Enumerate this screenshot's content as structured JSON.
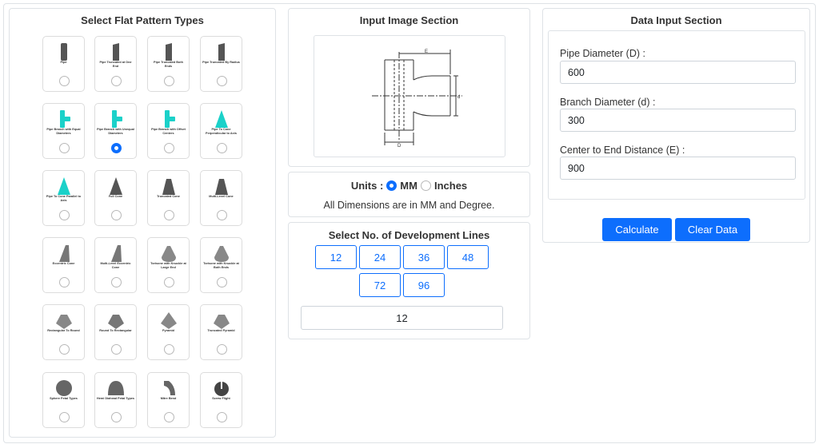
{
  "pattern_section": {
    "title": "Select Flat Pattern Types",
    "selected_index": 5,
    "items": [
      {
        "label": "Pipe",
        "icon": "pipe-icon",
        "color": "#555555"
      },
      {
        "label": "Pipe Truncated at One End",
        "icon": "pipe-truncated-one-end-icon",
        "color": "#555555"
      },
      {
        "label": "Pipe Truncated Both Ends",
        "icon": "pipe-truncated-both-ends-icon",
        "color": "#555555"
      },
      {
        "label": "Pipe Truncated By Radius",
        "icon": "pipe-truncated-radius-icon",
        "color": "#555555"
      },
      {
        "label": "Pipe Branch with Equal Diameters",
        "icon": "pipe-branch-equal-icon",
        "color": "#1bd1c9"
      },
      {
        "label": "Pipe Branch with Unequal Diameters",
        "icon": "pipe-branch-unequal-icon",
        "color": "#1bd1c9"
      },
      {
        "label": "Pipe Branch with Offset Centers",
        "icon": "pipe-branch-offset-icon",
        "color": "#1bd1c9"
      },
      {
        "label": "Pipe To Cone Perpendicular to Axis",
        "icon": "pipe-to-cone-perpendicular-icon",
        "color": "#1bd1c9"
      },
      {
        "label": "Pipe To Cone Parallel to Axis",
        "icon": "pipe-to-cone-parallel-icon",
        "color": "#1bd1c9"
      },
      {
        "label": "Full Cone",
        "icon": "full-cone-icon",
        "color": "#555555"
      },
      {
        "label": "Truncated Cone",
        "icon": "truncated-cone-icon",
        "color": "#555555"
      },
      {
        "label": "Multi-Level Cone",
        "icon": "multi-level-cone-icon",
        "color": "#555555"
      },
      {
        "label": "Eccentric Cone",
        "icon": "eccentric-cone-icon",
        "color": "#777777"
      },
      {
        "label": "Multi-Level Eccentric Cone",
        "icon": "multi-level-eccentric-cone-icon",
        "color": "#777777"
      },
      {
        "label": "Torisone with Knuckle at Large End",
        "icon": "torisone-large-end-icon",
        "color": "#888888"
      },
      {
        "label": "Torisone with Knuckle at Both Ends",
        "icon": "torisone-both-ends-icon",
        "color": "#888888"
      },
      {
        "label": "Rectangular To Round",
        "icon": "rectangular-to-round-icon",
        "color": "#888888"
      },
      {
        "label": "Round To Rectangular",
        "icon": "round-to-rectangular-icon",
        "color": "#777777"
      },
      {
        "label": "Pyramid",
        "icon": "pyramid-icon",
        "color": "#888888"
      },
      {
        "label": "Truncated Pyramid",
        "icon": "truncated-pyramid-icon",
        "color": "#888888"
      },
      {
        "label": "Sphere Petal Types",
        "icon": "sphere-petal-icon",
        "color": "#666666"
      },
      {
        "label": "Hemi Diahead Petal Types",
        "icon": "hemi-head-petal-icon",
        "color": "#666666"
      },
      {
        "label": "Mitre Bend",
        "icon": "mitre-bend-icon",
        "color": "#666666"
      },
      {
        "label": "Screw Flight",
        "icon": "screw-flight-icon",
        "color": "#444444"
      }
    ]
  },
  "image_section": {
    "title": "Input Image Section",
    "diagram_labels": {
      "top": "E",
      "right": "d",
      "bottom": "D"
    }
  },
  "units": {
    "label": "Units :",
    "options": [
      "MM",
      "Inches"
    ],
    "selected": "MM",
    "note": "All Dimensions are in MM and Degree."
  },
  "development_lines": {
    "title": "Select No. of Development Lines",
    "options": [
      "12",
      "24",
      "36",
      "48",
      "72",
      "96"
    ],
    "value": "12"
  },
  "data_section": {
    "title": "Data Input Section",
    "fields": [
      {
        "label": "Pipe Diameter (D) :",
        "value": "600"
      },
      {
        "label": "Branch Diameter (d) :",
        "value": "300"
      },
      {
        "label": "Center to End Distance (E) :",
        "value": "900"
      }
    ],
    "calculate_label": "Calculate",
    "clear_label": "Clear Data"
  },
  "colors": {
    "accent": "#0d6efd",
    "border": "#dee2e6"
  }
}
